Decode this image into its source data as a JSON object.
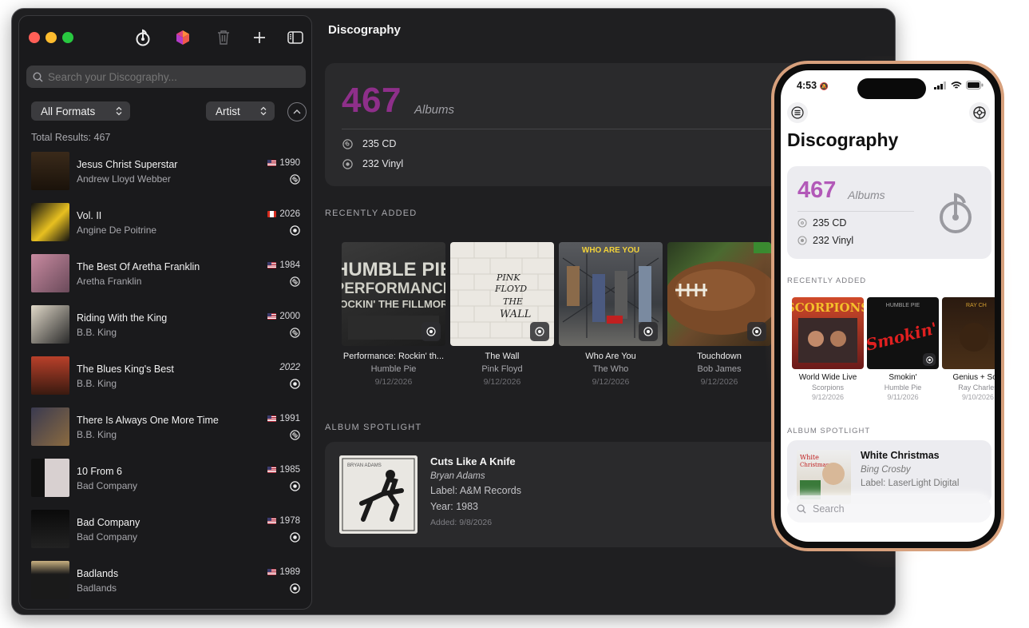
{
  "toolbar": {
    "icons": [
      "app-logo-icon",
      "color-cube-icon",
      "trash-icon",
      "plus-icon",
      "sidebar-toggle-icon"
    ]
  },
  "sidebar": {
    "search_placeholder": "Search your Discography...",
    "format_filter": "All Formats",
    "sort_field": "Artist",
    "total_results": "Total Results: 467",
    "items": [
      {
        "title": "Jesus Christ Superstar",
        "artist": "Andrew Lloyd Webber",
        "year": "1990",
        "flag": "us",
        "format": "cd"
      },
      {
        "title": "Vol. II",
        "artist": "Angine De Poitrine",
        "year": "2026",
        "flag": "ca",
        "format": "vinyl"
      },
      {
        "title": "The Best Of Aretha Franklin",
        "artist": "Aretha Franklin",
        "year": "1984",
        "flag": "us",
        "format": "cd"
      },
      {
        "title": "Riding With the King",
        "artist": "B.B. King",
        "year": "2000",
        "flag": "us",
        "format": "cd"
      },
      {
        "title": "The Blues King's Best",
        "artist": "B.B. King",
        "year": "2022",
        "flag": "",
        "format": "vinyl"
      },
      {
        "title": "There Is Always One More Time",
        "artist": "B.B. King",
        "year": "1991",
        "flag": "us",
        "format": "cd"
      },
      {
        "title": "10 From 6",
        "artist": "Bad Company",
        "year": "1985",
        "flag": "us",
        "format": "vinyl"
      },
      {
        "title": "Bad Company",
        "artist": "Bad Company",
        "year": "1978",
        "flag": "us",
        "format": "vinyl"
      },
      {
        "title": "Badlands",
        "artist": "Badlands",
        "year": "1989",
        "flag": "us",
        "format": "vinyl"
      }
    ]
  },
  "main": {
    "title": "Discography",
    "stats": {
      "total": "467",
      "total_label": "Albums",
      "cd": "235 CD",
      "vinyl": "232 Vinyl"
    },
    "recent_label": "RECENTLY ADDED",
    "recent": [
      {
        "title": "Performance: Rockin' th...",
        "artist": "Humble Pie",
        "date": "9/12/2026"
      },
      {
        "title": "The Wall",
        "artist": "Pink Floyd",
        "date": "9/12/2026"
      },
      {
        "title": "Who Are You",
        "artist": "The Who",
        "date": "9/12/2026"
      },
      {
        "title": "Touchdown",
        "artist": "Bob James",
        "date": "9/12/2026"
      }
    ],
    "spotlight_label": "ALBUM SPOTLIGHT",
    "spotlight": {
      "title": "Cuts Like A Knife",
      "artist": "Bryan Adams",
      "label": "Label: A&M Records",
      "year": "Year: 1983",
      "added": "Added: 9/8/2026"
    }
  },
  "phone": {
    "time": "4:53",
    "title": "Discography",
    "stats": {
      "total": "467",
      "total_label": "Albums",
      "cd": "235 CD",
      "vinyl": "232 Vinyl"
    },
    "recent_label": "RECENTLY ADDED",
    "recent": [
      {
        "title": "World Wide Live",
        "artist": "Scorpions",
        "date": "9/12/2026"
      },
      {
        "title": "Smokin'",
        "artist": "Humble Pie",
        "date": "9/11/2026"
      },
      {
        "title": "Genius + Soul",
        "artist": "Ray Charles",
        "date": "9/10/2026"
      }
    ],
    "spotlight_label": "ALBUM SPOTLIGHT",
    "spotlight": {
      "title": "White Christmas",
      "artist": "Bing Crosby",
      "label": "Label: LaserLight Digital"
    },
    "search_placeholder": "Search"
  },
  "colors": {
    "accent": "#8e2f8a",
    "accent_phone": "#b259b8",
    "window_bg": "#1f1f21",
    "card_bg": "#2a2a2c"
  }
}
